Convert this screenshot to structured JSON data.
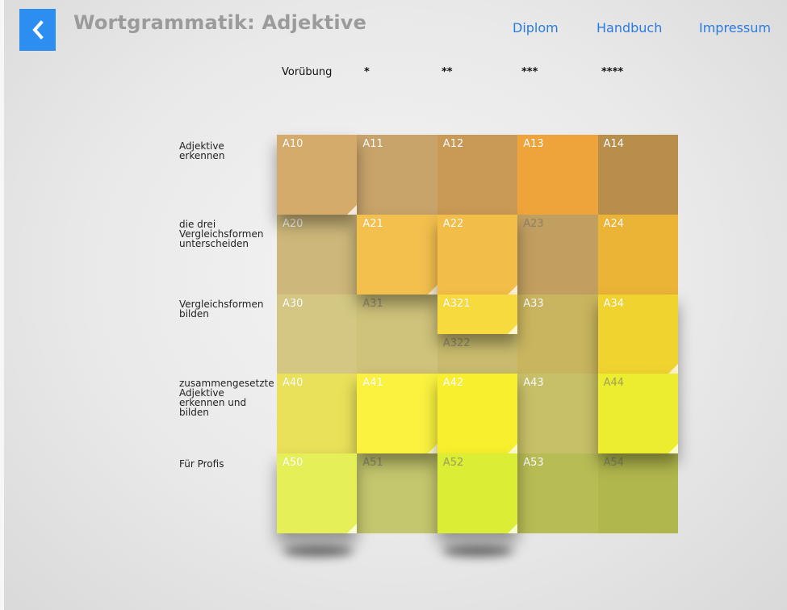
{
  "header": {
    "title": "Wortgrammatik: Adjektive",
    "nav": [
      "Diplom",
      "Handbuch",
      "Impressum"
    ]
  },
  "levels": [
    "Vorübung",
    "*",
    "**",
    "***",
    "****"
  ],
  "rows": [
    "Adjektive\nerkennen",
    "die drei\nVergleichsformen\nunterscheiden",
    "Vergleichsformen\nbilden",
    "zusammengesetzte\nAdjektive\nerkennen und\nbilden",
    "Für Profis"
  ],
  "tiles": [
    {
      "code": "A10",
      "color": "#d5ab6b",
      "raised": true
    },
    {
      "code": "A11",
      "color": "#c8a46b",
      "raised": false
    },
    {
      "code": "A12",
      "color": "#c99a55",
      "raised": false
    },
    {
      "code": "A13",
      "color": "#eea43a",
      "raised": false
    },
    {
      "code": "A14",
      "color": "#b88e4a",
      "raised": false
    },
    {
      "code": "A20",
      "color": "#cdb77a",
      "raised": false
    },
    {
      "code": "A21",
      "color": "#f3c04e",
      "raised": true
    },
    {
      "code": "A22",
      "color": "#f2be47",
      "raised": true
    },
    {
      "code": "A23",
      "color": "#c19f60",
      "raised": false,
      "dim": true
    },
    {
      "code": "A24",
      "color": "#ecb437",
      "raised": false
    },
    {
      "code": "A30",
      "color": "#d3c783",
      "raised": false
    },
    {
      "code": "A31",
      "color": "#cfc27a",
      "raised": false,
      "dim": true
    },
    {
      "code": "A321",
      "color": "#f6da3e",
      "raised": true,
      "half": "top"
    },
    {
      "code": "A322",
      "color": "#c9bb6d",
      "raised": false,
      "half": "bottom",
      "dim": true
    },
    {
      "code": "A33",
      "color": "#c9b55f",
      "raised": false
    },
    {
      "code": "A34",
      "color": "#f1d330",
      "raised": true
    },
    {
      "code": "A40",
      "color": "#eae15a",
      "raised": false
    },
    {
      "code": "A41",
      "color": "#faf23f",
      "raised": true
    },
    {
      "code": "A42",
      "color": "#f8f02e",
      "raised": true
    },
    {
      "code": "A43",
      "color": "#c8c068",
      "raised": false
    },
    {
      "code": "A44",
      "color": "#eded30",
      "raised": true,
      "dim": true
    },
    {
      "code": "A50",
      "color": "#e5f059",
      "raised": true
    },
    {
      "code": "A51",
      "color": "#c4c76e",
      "raised": false,
      "dim": true
    },
    {
      "code": "A52",
      "color": "#dced36",
      "raised": true,
      "dim": true
    },
    {
      "code": "A53",
      "color": "#b7bc55",
      "raised": false
    },
    {
      "code": "A54",
      "color": "#b0b74c",
      "raised": false,
      "dim": true
    }
  ],
  "colors": {
    "accent": "#2c8ef0",
    "title": "#9b9b9b",
    "link": "#2a7be0"
  },
  "icons": {
    "back": "chevron-left-icon"
  }
}
